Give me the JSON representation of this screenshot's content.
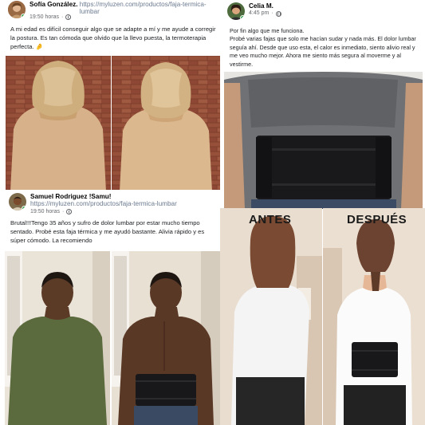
{
  "posts": [
    {
      "author": "Sofía González.",
      "link": "https://myluzen.com/productos/faja-termica-lumbar",
      "time": "19:50 horas",
      "text": "A mi edad es difícil conseguir algo que se adapte a mí y me ayude a corregir la postura. Es tan cómoda que olvido que la llevo puesta, la termoterapia perfecta.",
      "emoji": "🤌"
    },
    {
      "author": "Celia M.",
      "time": "4:45 pm",
      "text": "Por fin algo que me funciona.\nProbé varias fajas que solo me hacían sudar y nada más. El dolor lumbar seguía ahí. Desde que uso esta, el calor es inmediato, siento alivio real y me veo mucho mejor. Ahora me siento más segura al moverme y al vestirme."
    },
    {
      "author": "Samuel Rodriguez !Samu!",
      "link": "https://myluzen.com/productos/faja-termica-lumbar",
      "time": "19:50 horas",
      "text": "Brutal!!!Tengo 35 años y sufro de dolor lumbar por estar mucho tiempo sentado. Probé esta faja térmica y me ayudó bastante. Alivia rápido y es súper cómodo. La recomiendo"
    }
  ],
  "before_after": {
    "before": "ANTES",
    "after": "DESPUÉS"
  },
  "colors": {
    "online": "#31a24c",
    "belt": "#1b1b1d",
    "sweater": "#d9b48a",
    "brick": "#8a4a34"
  }
}
